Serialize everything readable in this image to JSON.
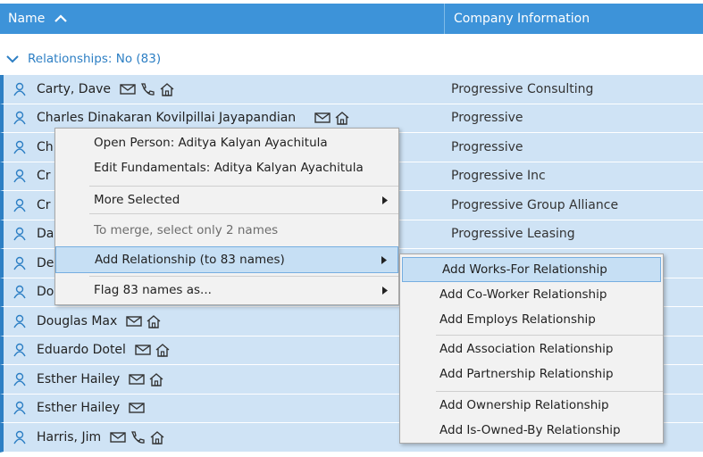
{
  "header": {
    "name_col": "Name",
    "company_col": "Company Information"
  },
  "group": {
    "label": "Relationships: No (83)"
  },
  "rows": [
    {
      "name": "Carty, Dave",
      "company": "Progressive Consulting"
    },
    {
      "name": "Charles Dinakaran Kovilpillai Jayapandian",
      "company": "Progressive"
    },
    {
      "name": "Ch",
      "company": "Progressive"
    },
    {
      "name": "Cr",
      "company": "Progressive Inc"
    },
    {
      "name": "Cr",
      "company": "Progressive Group Alliance"
    },
    {
      "name": "Da",
      "company": "Progressive Leasing"
    },
    {
      "name": "De",
      "company": ""
    },
    {
      "name": "Do",
      "company": ""
    },
    {
      "name": "Douglas Max",
      "company": ""
    },
    {
      "name": "Eduardo Dotel",
      "company": ""
    },
    {
      "name": "Esther Hailey",
      "company": ""
    },
    {
      "name": "Esther Hailey",
      "company": ""
    },
    {
      "name": "Harris, Jim",
      "company": ""
    }
  ],
  "context_menu": {
    "open_person": "Open Person: Aditya Kalyan Ayachitula",
    "edit_fundamentals": "Edit Fundamentals: Aditya Kalyan Ayachitula",
    "more_selected": "More Selected",
    "merge_hint": "To merge, select only 2 names",
    "add_relationship": "Add Relationship (to 83 names)",
    "flag_names": "Flag 83 names as..."
  },
  "submenu": {
    "works_for": "Add Works-For Relationship",
    "co_worker": "Add Co-Worker Relationship",
    "employs": "Add Employs Relationship",
    "association": "Add Association Relationship",
    "partnership": "Add Partnership Relationship",
    "ownership": "Add Ownership Relationship",
    "is_owned_by": "Add Is-Owned-By Relationship"
  },
  "colors": {
    "header_bg": "#3d93d9",
    "row_bg": "#cfe3f5",
    "accent": "#2d7fc4",
    "menu_highlight": "#c6dff4"
  }
}
